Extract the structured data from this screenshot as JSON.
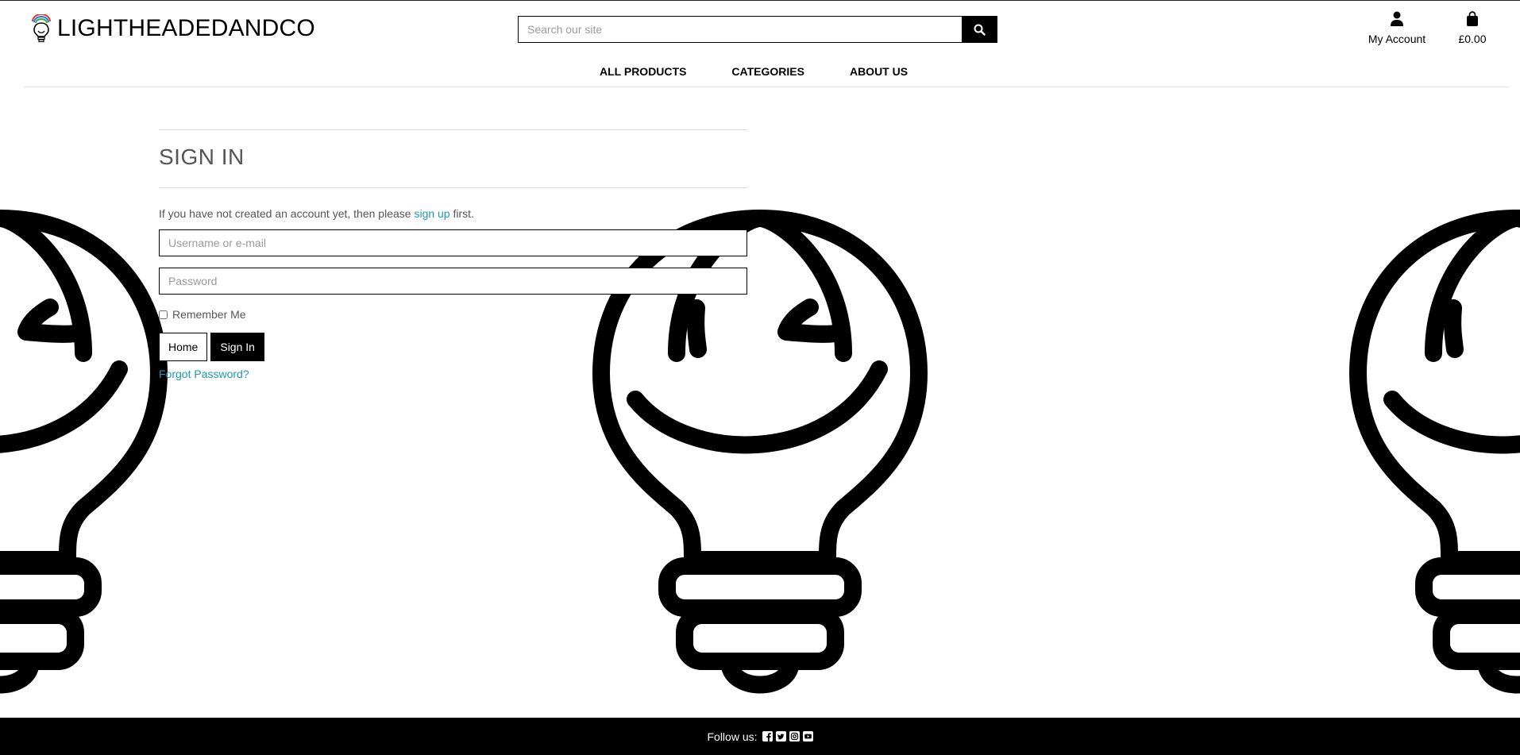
{
  "brand": {
    "name": "LIGHTHEADEDANDCO"
  },
  "search": {
    "placeholder": "Search our site",
    "icon": "search-icon"
  },
  "account": {
    "label": "My Account",
    "icon": "user-icon"
  },
  "cart": {
    "total": "£0.00",
    "icon": "shopping-bag-icon"
  },
  "nav": {
    "items": [
      "ALL PRODUCTS",
      "CATEGORIES",
      "ABOUT US"
    ]
  },
  "signin": {
    "title": "SIGN IN",
    "intro_before": "If you have not created an account yet, then please ",
    "intro_link": "sign up",
    "intro_after": " first.",
    "username_placeholder": "Username or e-mail",
    "password_placeholder": "Password",
    "remember_label": "Remember Me",
    "home_button": "Home",
    "signin_button": "Sign In",
    "forgot_link": "Forgot Password?"
  },
  "footer": {
    "follow_label": "Follow us:",
    "socials": [
      "facebook-icon",
      "twitter-icon",
      "instagram-icon",
      "youtube-icon"
    ]
  },
  "colors": {
    "accent_link": "#1b9bb2",
    "primary": "#000000",
    "footer_bg": "#000000"
  }
}
